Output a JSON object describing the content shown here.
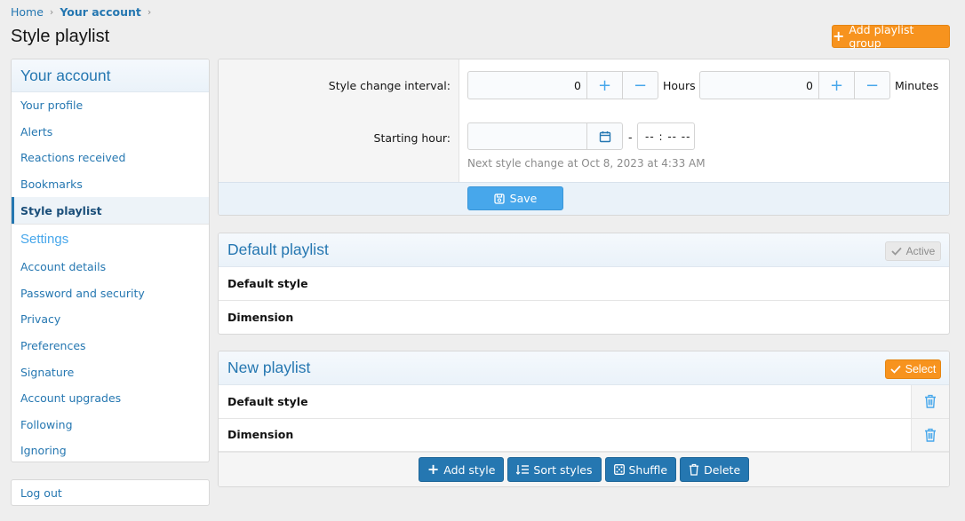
{
  "breadcrumb": {
    "home": "Home",
    "current": "Your account"
  },
  "page_title": "Style playlist",
  "header": {
    "add_group_label": "Add playlist group"
  },
  "sidebar": {
    "title": "Your account",
    "items": [
      "Your profile",
      "Alerts",
      "Reactions received",
      "Bookmarks",
      "Style playlist"
    ],
    "settings_title": "Settings",
    "settings_items": [
      "Account details",
      "Password and security",
      "Privacy",
      "Preferences",
      "Signature",
      "Account upgrades",
      "Following",
      "Ignoring"
    ],
    "logout": "Log out"
  },
  "settings": {
    "interval_label": "Style change interval:",
    "hours_value": "0",
    "hours_unit": "Hours",
    "minutes_value": "0",
    "minutes_unit": "Minutes",
    "start_label": "Starting hour:",
    "dash": "-",
    "time_placeholder": "-- : --   --",
    "hint": "Next style change at Oct 8, 2023 at 4:33 AM",
    "save_label": "Save"
  },
  "playlists": [
    {
      "title": "Default playlist",
      "badge": "Active",
      "styles": [
        "Default style",
        "Dimension"
      ]
    },
    {
      "title": "New playlist",
      "badge": "Select",
      "styles": [
        "Default style",
        "Dimension"
      ],
      "actions": {
        "add": "Add style",
        "sort": "Sort styles",
        "shuffle": "Shuffle",
        "delete": "Delete"
      }
    }
  ],
  "colors": {
    "accent": "#2577b1",
    "light_accent": "#47a7eb",
    "orange": "#f7931e"
  }
}
